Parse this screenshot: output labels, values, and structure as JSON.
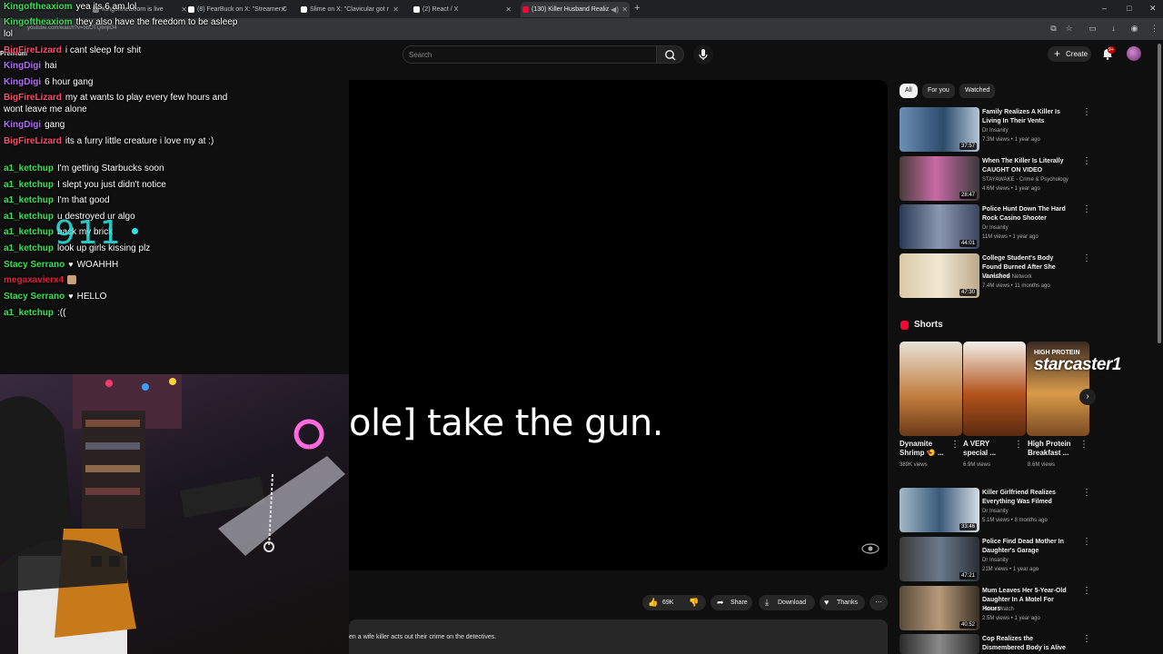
{
  "browser": {
    "tabs": [
      {
        "label": "Kingoftheaxiom is live"
      },
      {
        "label": "(8) FearBuck on X: \"Streamer C"
      },
      {
        "label": "Slime on X: \"Clavicular got r"
      },
      {
        "label": "(2) React / X"
      },
      {
        "label": "(130) Killer Husband Realiz"
      }
    ],
    "url": "youtube.com/watch?v=5bOTQ6njlO4",
    "window_controls": [
      "–",
      "□",
      "✕"
    ]
  },
  "youtube": {
    "premium_label": "Premium",
    "search_placeholder": "Search",
    "create_label": "Create",
    "notification_count": "9+"
  },
  "player": {
    "caption": "ole] take the gun."
  },
  "actions": {
    "like_count": "69K",
    "share_label": "Share",
    "download_label": "Download",
    "thanks_label": "Thanks",
    "description": "en a wife killer acts out their crime on the detectives."
  },
  "filter_chips": [
    "All",
    "For you",
    "Watched"
  ],
  "recommendations": [
    {
      "title": "Family Realizes A Killer Is Living In Their Vents",
      "channel": "Dr Insanity",
      "meta": "7.3M views • 1 year ago",
      "duration": "37:57"
    },
    {
      "title": "When The Killer Is Literally CAUGHT ON VIDEO",
      "channel": "STAYAWAKE - Crime & Psychology",
      "meta": "4.6M views • 1 year ago",
      "duration": "28:47"
    },
    {
      "title": "Police Hunt Down The Hard Rock Casino Shooter",
      "channel": "Dr Insanity",
      "meta": "11M views • 1 year ago",
      "duration": "44:01"
    },
    {
      "title": "College Student's Body Found Burned After She Vanished",
      "channel": "Law&Crime Network",
      "meta": "7.4M views • 11 months ago",
      "duration": "47:30"
    }
  ],
  "shorts": {
    "heading": "Shorts",
    "items": [
      {
        "title": "Dynamite Shrimp 🍤 ...",
        "views": "389K views"
      },
      {
        "title": "A VERY special ...",
        "views": "6.9M views"
      },
      {
        "title": "High Protein Breakfast ...",
        "views": "8.6M views"
      }
    ],
    "thumb3_text": "HIGH PROTEIN"
  },
  "recommendations_lower": [
    {
      "title": "Killer Girlfriend Realizes Everything Was Filmed",
      "channel": "Dr Insanity",
      "meta": "5.1M views • 8 months ago",
      "duration": "33:46"
    },
    {
      "title": "Police Find Dead Mother In Daughter's Garage",
      "channel": "Dr Insanity",
      "meta": "21M views • 1 year ago",
      "duration": "47:21"
    },
    {
      "title": "Mum Leaves Her 5-Year-Old Daughter In A Motel For Hours",
      "channel": "Police Watch",
      "meta": "2.5M views • 1 year ago",
      "duration": "40:52"
    },
    {
      "title": "Cop Realizes the Dismembered Body is Alive",
      "channel": "",
      "meta": "",
      "duration": ""
    }
  ],
  "chat": [
    {
      "user": "Kingoftheaxiom",
      "color": "#3ee05a",
      "text": "yea its 6 am lol"
    },
    {
      "user": "Kingoftheaxiom",
      "color": "#3ee05a",
      "text": "they also have the freedom to be asleep lol"
    },
    {
      "user": "BigFireLizard",
      "color": "#ff4d6d",
      "text": "i cant sleep for shit"
    },
    {
      "user": "KingDigi",
      "color": "#b36bff",
      "text": "hai"
    },
    {
      "user": "KingDigi",
      "color": "#b36bff",
      "text": "6 hour gang"
    },
    {
      "user": "BigFireLizard",
      "color": "#ff4d6d",
      "text": "my at wants to play every few hours and wont leave me alone"
    },
    {
      "user": "KingDigi",
      "color": "#b36bff",
      "text": "gang"
    },
    {
      "user": "BigFireLizard",
      "color": "#ff4d6d",
      "text": "its a furry little creature i love my at :)"
    },
    {
      "user": "a1_ketchup",
      "color": "#3ee05a",
      "text": "I'm getting Starbucks soon"
    },
    {
      "user": "a1_ketchup",
      "color": "#3ee05a",
      "text": "I slept you just didn't notice"
    },
    {
      "user": "a1_ketchup",
      "color": "#3ee05a",
      "text": "I'm that good"
    },
    {
      "user": "a1_ketchup",
      "color": "#3ee05a",
      "text": "u destroyed ur algo"
    },
    {
      "user": "a1_ketchup",
      "color": "#3ee05a",
      "text": "back my brick"
    },
    {
      "user": "a1_ketchup",
      "color": "#3ee05a",
      "text": "look up girls kissing plz"
    },
    {
      "user": "Stacy Serrano",
      "color": "#3ee05a",
      "text": "WOAHHH",
      "heart": true
    },
    {
      "user": "megaxavierx4",
      "color": "#e3223a",
      "text": "",
      "emote": true
    },
    {
      "user": "Stacy Serrano",
      "color": "#3ee05a",
      "text": "HELLO",
      "heart": true
    },
    {
      "user": "a1_ketchup",
      "color": "#3ee05a",
      "text": ":(("
    }
  ],
  "overlay": {
    "alert_text": "911",
    "watermark": "starcaster1"
  }
}
